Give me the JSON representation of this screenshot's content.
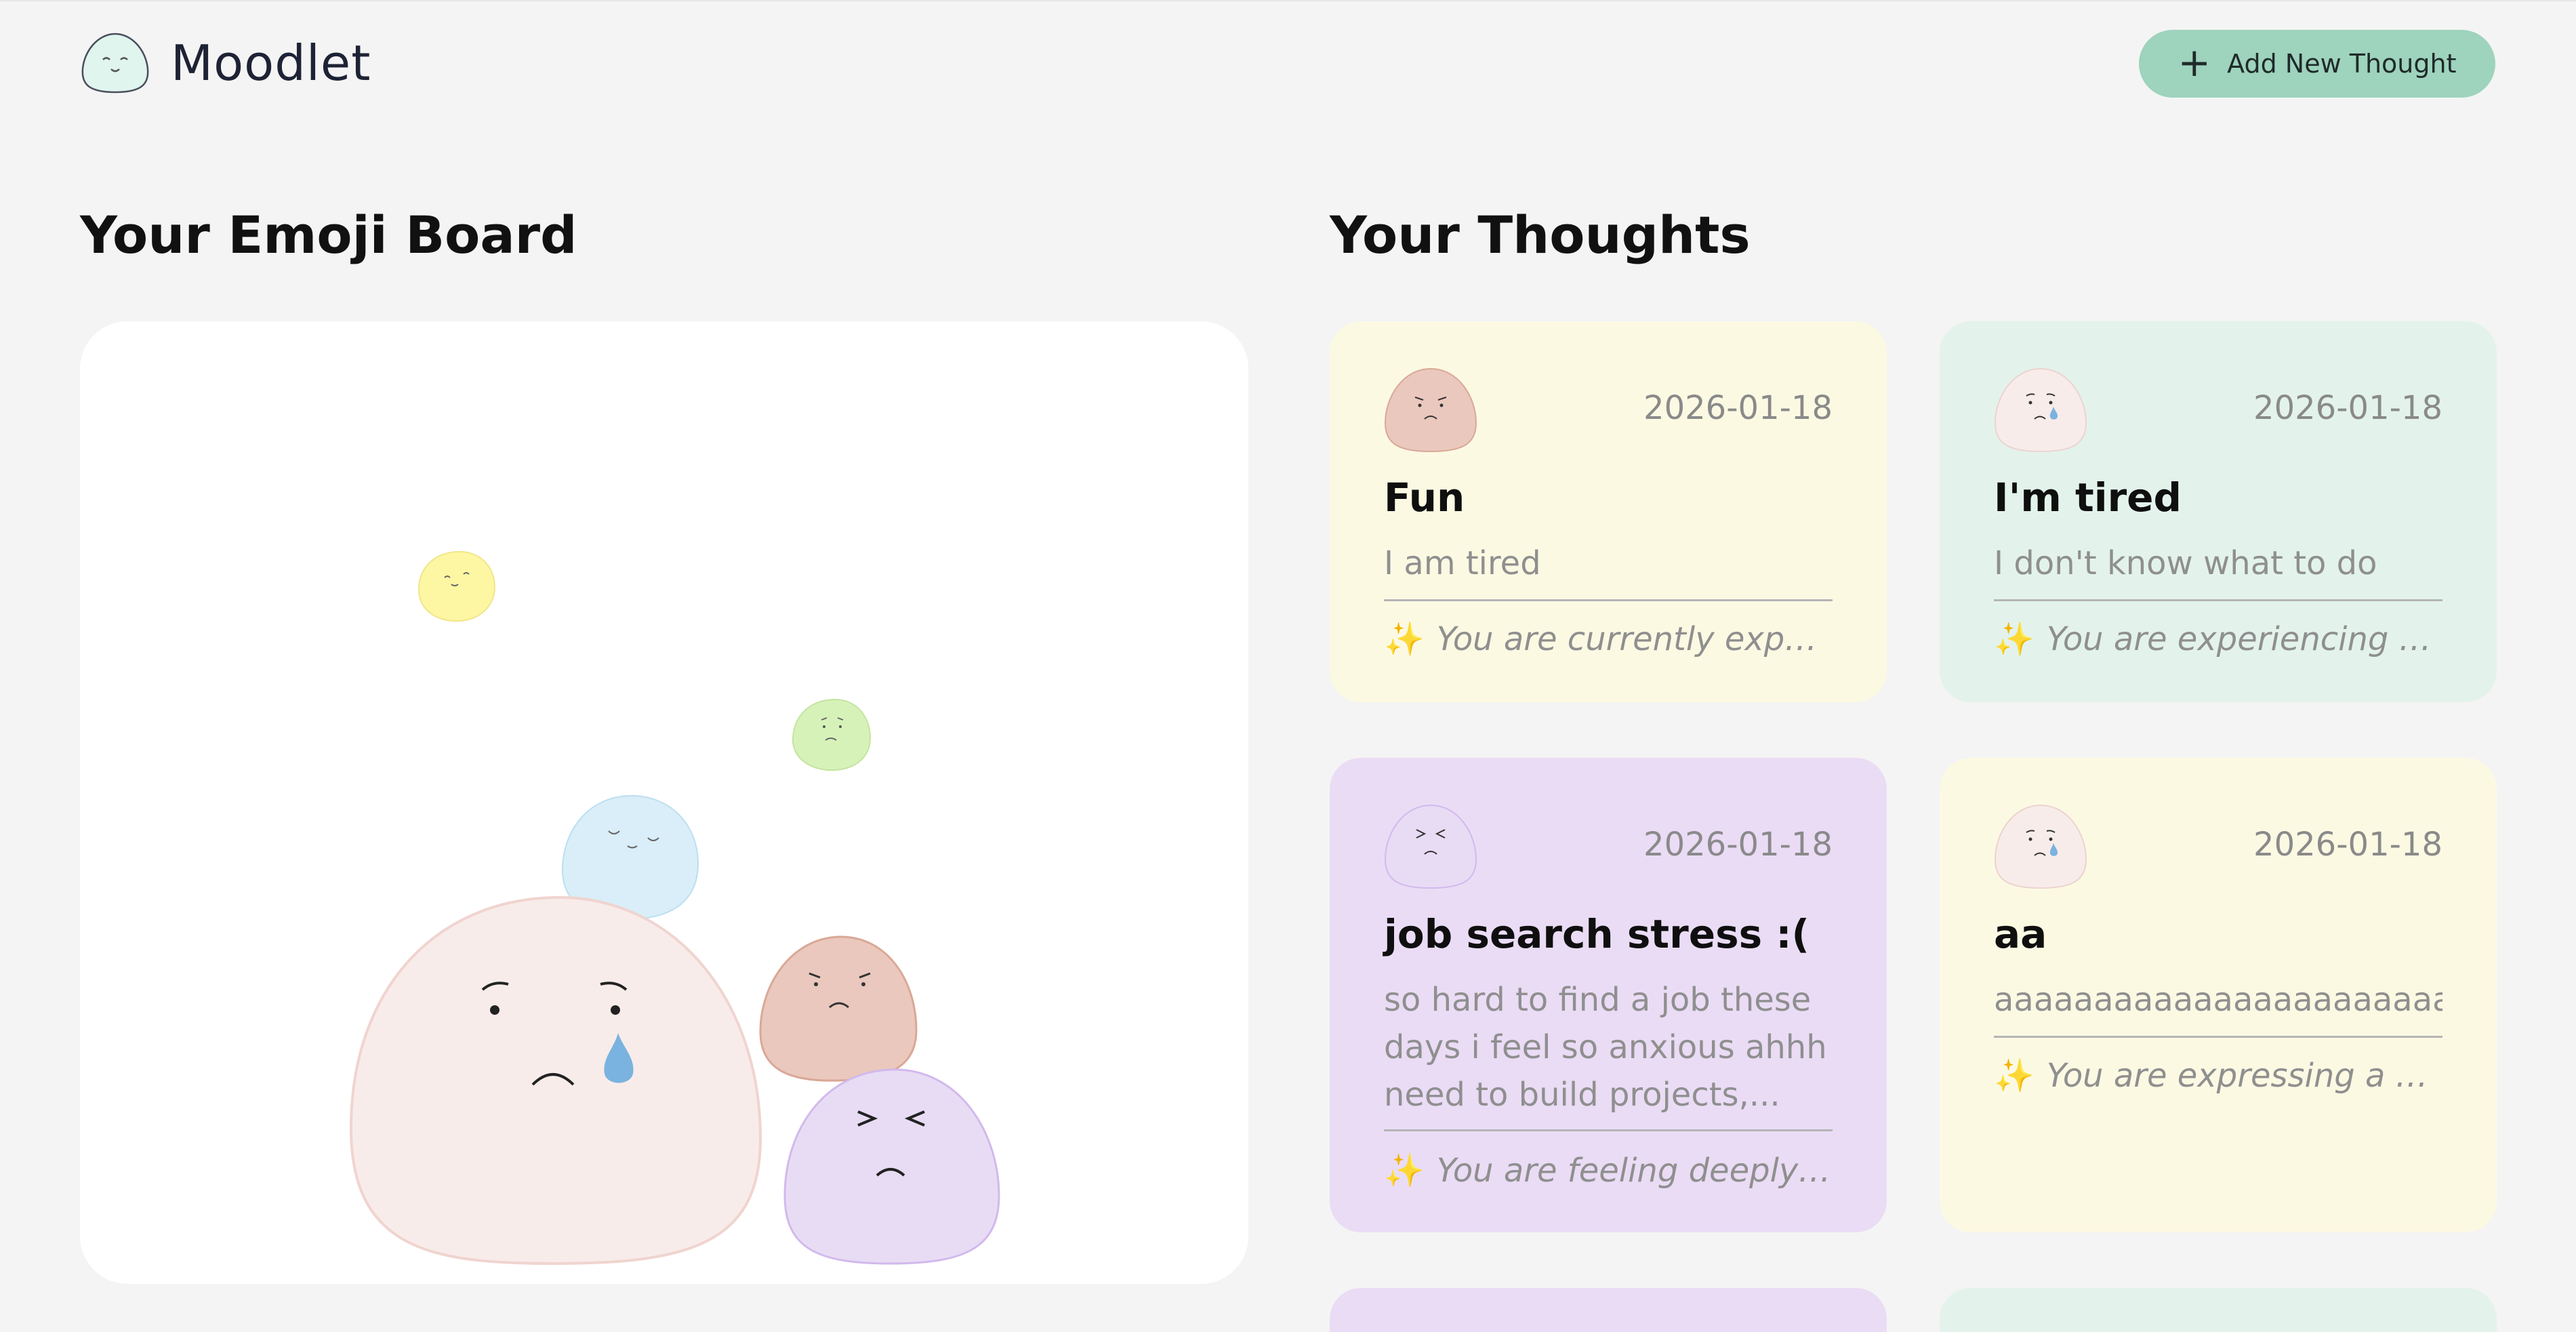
{
  "header": {
    "app_name": "Moodlet",
    "logo_icon": "blob-face-icon",
    "add_button_label": "Add New Thought",
    "add_button_icon": "plus-icon"
  },
  "emoji_board": {
    "title": "Your Emoji Board",
    "blobs": [
      {
        "mood": "calm",
        "color": "#fdf5a0"
      },
      {
        "mood": "worried",
        "color": "#d6f2b8"
      },
      {
        "mood": "content",
        "color": "#d8eef8"
      },
      {
        "mood": "sad",
        "color": "#f8ecea"
      },
      {
        "mood": "angry",
        "color": "#eac8bd"
      },
      {
        "mood": "stressed",
        "color": "#e8dcf5"
      }
    ]
  },
  "thoughts": {
    "title": "Your Thoughts",
    "cards": [
      {
        "mood_icon": "angry-blob-icon",
        "date": "2026-01-18",
        "title": "Fun",
        "text": "I am tired",
        "insight_icon": "sparkles-icon",
        "insight": "You are currently experi...",
        "color": "#fcf9e3"
      },
      {
        "mood_icon": "sad-blob-icon",
        "date": "2026-01-18",
        "title": "I'm tired",
        "text": "I don't know what to do",
        "insight_icon": "sparkles-icon",
        "insight": "You are experiencing a ...",
        "color": "#e3f3ec"
      },
      {
        "mood_icon": "stressed-blob-icon",
        "date": "2026-01-18",
        "title": "job search stress :(",
        "text": "so hard to find a job these days i feel so anxious ahhh need to build projects,...",
        "insight_icon": "sparkles-icon",
        "insight": "You are feeling deeply ...",
        "color": "#eadcf5"
      },
      {
        "mood_icon": "sad-blob-icon",
        "date": "2026-01-18",
        "title": "aa",
        "text": "aaaaaaaaaaaaaaaaaaaaaaa",
        "insight_icon": "sparkles-icon",
        "insight": "You are expressing a pr...",
        "color": "#fcf9e3"
      }
    ]
  }
}
